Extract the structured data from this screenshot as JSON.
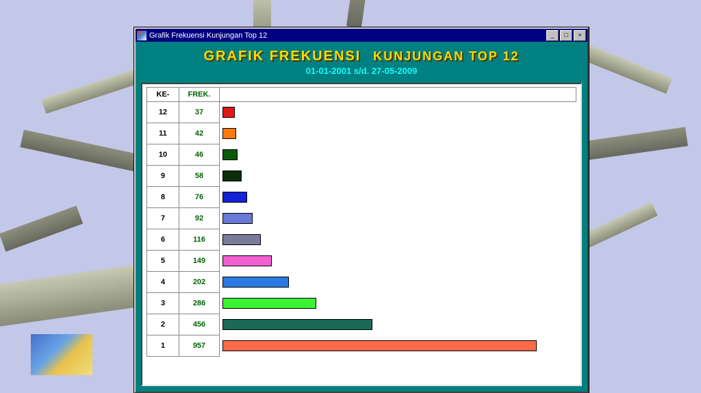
{
  "window": {
    "title": "Grafik Frekuensi Kunjungan Top 12",
    "min_glyph": "_",
    "max_glyph": "□",
    "close_glyph": "×"
  },
  "header": {
    "title_line1": "GRAFIK FREKUENSI",
    "title_line2": "KUNJUNGAN TOP 12",
    "date_range": "01-01-2001 s/d. 27-05-2009"
  },
  "columns": {
    "ke": "KE-",
    "frek": "FREK."
  },
  "rows": [
    {
      "ke": "12",
      "frek": "37",
      "value": 37,
      "color": "#e21818"
    },
    {
      "ke": "11",
      "frek": "42",
      "value": 42,
      "color": "#ff7a0c"
    },
    {
      "ke": "10",
      "frek": "46",
      "value": 46,
      "color": "#0a5a0a"
    },
    {
      "ke": "9",
      "frek": "58",
      "value": 58,
      "color": "#0b2d0b"
    },
    {
      "ke": "8",
      "frek": "76",
      "value": 76,
      "color": "#1522d6"
    },
    {
      "ke": "7",
      "frek": "92",
      "value": 92,
      "color": "#6a78d8"
    },
    {
      "ke": "6",
      "frek": "116",
      "value": 116,
      "color": "#7a7a9a"
    },
    {
      "ke": "5",
      "frek": "149",
      "value": 149,
      "color": "#f25fcf"
    },
    {
      "ke": "4",
      "frek": "202",
      "value": 202,
      "color": "#2a7ae0"
    },
    {
      "ke": "3",
      "frek": "286",
      "value": 286,
      "color": "#3bf233"
    },
    {
      "ke": "2",
      "frek": "456",
      "value": 456,
      "color": "#1a6a56"
    },
    {
      "ke": "1",
      "frek": "957",
      "value": 957,
      "color": "#ff6a4a"
    }
  ],
  "chart_data": {
    "type": "bar",
    "orientation": "horizontal",
    "title": "GRAFIK FREKUENSI KUNJUNGAN TOP 12",
    "subtitle": "01-01-2001 s/d. 27-05-2009",
    "xlabel": "FREK.",
    "ylabel": "KE-",
    "categories": [
      "12",
      "11",
      "10",
      "9",
      "8",
      "7",
      "6",
      "5",
      "4",
      "3",
      "2",
      "1"
    ],
    "values": [
      37,
      42,
      46,
      58,
      76,
      92,
      116,
      149,
      202,
      286,
      456,
      957
    ],
    "colors": [
      "#e21818",
      "#ff7a0c",
      "#0a5a0a",
      "#0b2d0b",
      "#1522d6",
      "#6a78d8",
      "#7a7a9a",
      "#f25fcf",
      "#2a7ae0",
      "#3bf233",
      "#1a6a56",
      "#ff6a4a"
    ],
    "xlim": [
      0,
      1000
    ]
  }
}
